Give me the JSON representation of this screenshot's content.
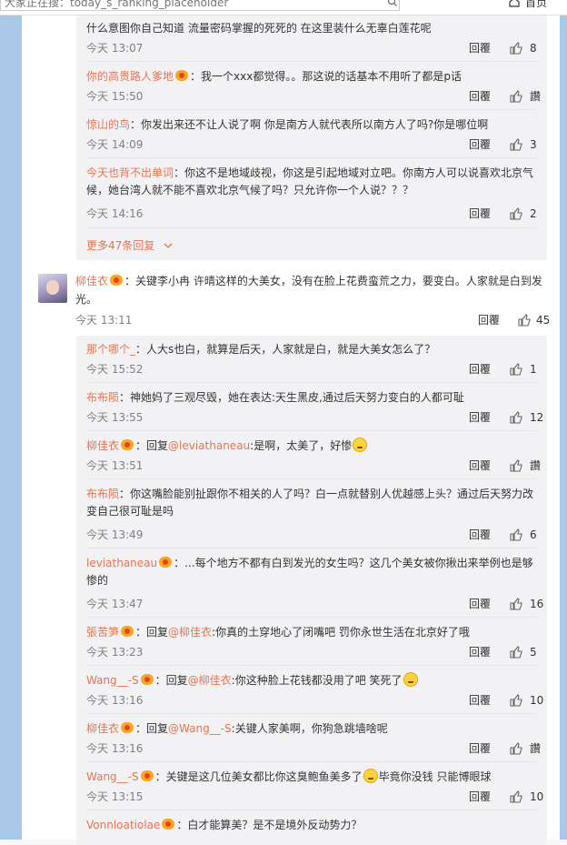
{
  "topbar": {
    "search_placeholder": "大家正在搜：today_s_ranking_placeholder",
    "hot_text": "",
    "home_label": "首页"
  },
  "ui": {
    "reply_label": "回覆",
    "like_label": "讚",
    "more_label": "更多47条回复"
  },
  "block1": [
    {
      "user": "",
      "vip": false,
      "text": "什么意图你自己知道 流量密码掌握的死死的 在这里装什么无辜白莲花呢",
      "time": "今天 13:07",
      "likes": "8"
    },
    {
      "user": "你的高贵路人爹地",
      "vip": true,
      "text": "：我一个xxx都觉得。。那这说的话基本不用听了都是p话",
      "time": "今天 15:50",
      "likes": "讚"
    },
    {
      "user": "惊山的鸟",
      "vip": false,
      "text": "：你发出来还不让人说了啊  你是南方人就代表所以南方人了吗?你是哪位啊",
      "time": "今天 14:09",
      "likes": "3"
    },
    {
      "user": "今天也背不出单词",
      "vip": false,
      "text": "：你这不是地域歧视，你这是引起地域对立吧。你南方人可以说喜欢北京气候，她台湾人就不能不喜欢北京气候了吗？只允许你一个人说？？？",
      "time": "今天 14:16",
      "likes": "2"
    }
  ],
  "main_comment": {
    "user": "柳佳衣",
    "text": "：关键李小冉 许晴这样的大美女，没有在脸上花费蛮荒之力，要变白。人家就是白到发光。",
    "time": "今天 13:11",
    "likes": "45"
  },
  "block2": [
    {
      "user": "那个哪个_",
      "vip": false,
      "pre": "：人大s也白，就算是后天，人家就是白，就是大美女怎么了？",
      "mention": "",
      "post": "",
      "emoji": false,
      "time": "今天 15:52",
      "likes": "1"
    },
    {
      "user": "布布陨",
      "vip": false,
      "pre": "：神她妈了三观尽毁，她在表达:天生黑皮,通过后天努力变白的人都可耻",
      "mention": "",
      "post": "",
      "emoji": false,
      "time": "今天 13:55",
      "likes": "12"
    },
    {
      "user": "柳佳衣",
      "vip": true,
      "pre": "：回复",
      "mention": "@leviathaneau",
      "post": ":是啊，太美了，好惨",
      "emoji": true,
      "time": "今天 13:51",
      "likes": "讚"
    },
    {
      "user": "布布陨",
      "vip": false,
      "pre": "：你这嘴脸能别扯跟你不相关的人了吗？白一点就替别人优越感上头？通过后天努力改变自己很可耻是吗",
      "mention": "",
      "post": "",
      "emoji": false,
      "time": "今天 13:49",
      "likes": "6"
    },
    {
      "user": "leviathaneau",
      "vip": true,
      "pre": "：...每个地方不都有白到发光的女生吗？这几个美女被你揪出来举例也是够惨的",
      "mention": "",
      "post": "",
      "emoji": false,
      "time": "今天 13:47",
      "likes": "16"
    },
    {
      "user": "張苦笋",
      "vip": true,
      "pre": "：回复",
      "mention": "@柳佳衣",
      "post": ":你真的土穿地心了闭嘴吧 罚你永世生活在北京好了哦",
      "emoji": false,
      "time": "今天 13:23",
      "likes": "5"
    },
    {
      "user": "Wang__-S",
      "vip": true,
      "pre": "：回复",
      "mention": "@柳佳衣",
      "post": ":你这种脸上花钱都没用了吧 笑死了",
      "emoji": true,
      "time": "今天 13:16",
      "likes": "10"
    },
    {
      "user": "柳佳衣",
      "vip": true,
      "pre": "：回复",
      "mention": "@Wang__-S",
      "post": ":关键人家美啊，你狗急跳墙啥呢",
      "emoji": false,
      "time": "今天 13:16",
      "likes": "讚"
    },
    {
      "user": "Wang__-S",
      "vip": true,
      "pre": "：关键是这几位美女都比你这臭鲍鱼美多了",
      "mention": "",
      "post": "毕竟你没钱 只能博眼球",
      "emoji": true,
      "time": "今天 13:15",
      "likes": "10"
    },
    {
      "user": "Vonnloatiolae",
      "vip": true,
      "pre": "：白才能算美？是不是境外反动势力？",
      "mention": "",
      "post": "",
      "emoji": false,
      "time": "",
      "likes": ""
    }
  ]
}
